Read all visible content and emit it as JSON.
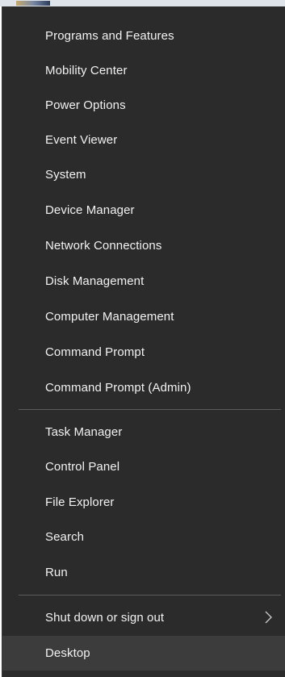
{
  "menu": {
    "group1": [
      {
        "label": "Programs and Features"
      },
      {
        "label": "Mobility Center"
      },
      {
        "label": "Power Options"
      },
      {
        "label": "Event Viewer"
      },
      {
        "label": "System"
      },
      {
        "label": "Device Manager"
      },
      {
        "label": "Network Connections"
      },
      {
        "label": "Disk Management"
      },
      {
        "label": "Computer Management"
      },
      {
        "label": "Command Prompt"
      },
      {
        "label": "Command Prompt (Admin)"
      }
    ],
    "group2": [
      {
        "label": "Task Manager"
      },
      {
        "label": "Control Panel"
      },
      {
        "label": "File Explorer"
      },
      {
        "label": "Search"
      },
      {
        "label": "Run"
      }
    ],
    "group3": [
      {
        "label": "Shut down or sign out",
        "submenu": true,
        "icon": "chevron-right-icon"
      },
      {
        "label": "Desktop",
        "highlighted": true
      }
    ]
  },
  "colors": {
    "menu_bg": "#2b2b2b",
    "text": "#f2f2f2",
    "separator": "#5c5c5c",
    "hover": "#3c3c3c"
  }
}
